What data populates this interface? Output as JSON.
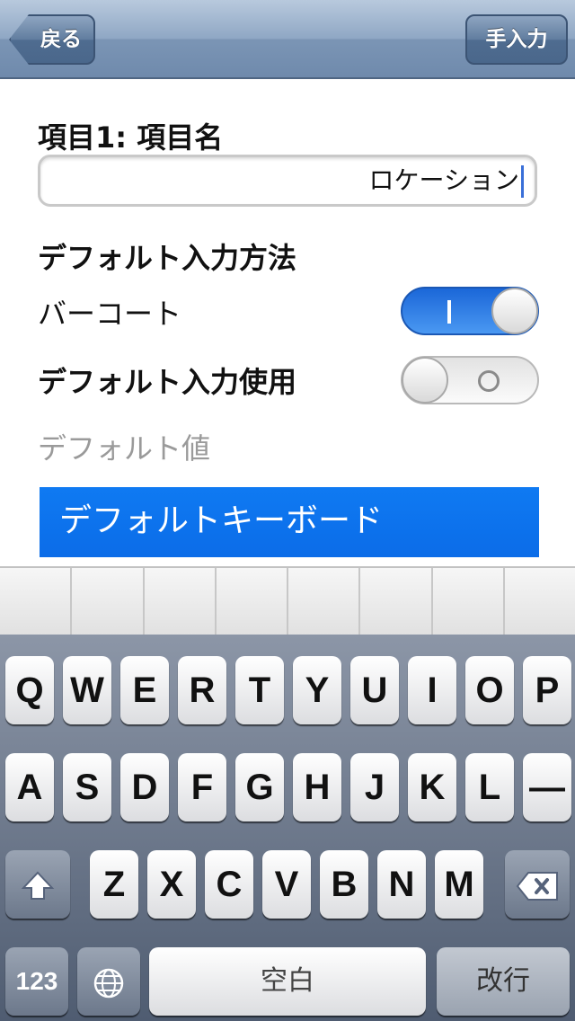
{
  "navbar": {
    "back_label": "戻る",
    "manual_label": "手入力"
  },
  "form": {
    "item_label": "項目1: 項目名",
    "item_value": "ロケーション",
    "default_method_label": "デフォルト入力方法",
    "barcode_label": "バーコート",
    "barcode_switch_on": true,
    "default_use_label": "デフォルト入力使用",
    "default_use_switch_on": false,
    "default_value_label": "デフォルト値",
    "default_keyboard_label": "デフォルトキーボード"
  },
  "keyboard": {
    "row1": [
      "Q",
      "W",
      "E",
      "R",
      "T",
      "Y",
      "U",
      "I",
      "O",
      "P"
    ],
    "row2": [
      "A",
      "S",
      "D",
      "F",
      "G",
      "H",
      "J",
      "K",
      "L",
      "—"
    ],
    "row3": [
      "Z",
      "X",
      "C",
      "V",
      "B",
      "N",
      "M"
    ],
    "numbers_label": "123",
    "space_label": "空白",
    "return_label": "改行",
    "icons": [
      "shift-icon",
      "backspace-icon",
      "globe-icon"
    ]
  }
}
